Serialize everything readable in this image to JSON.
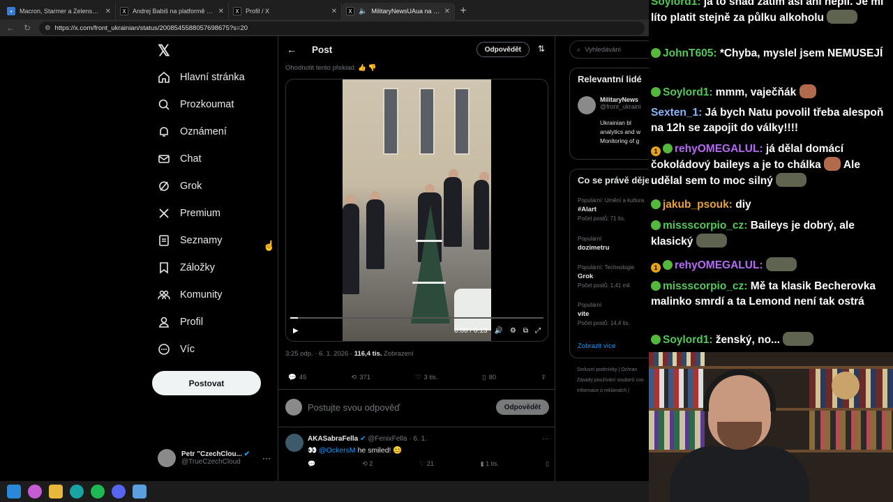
{
  "browser": {
    "tabs": [
      {
        "label": "Macron, Starmer a Zelenskyj pode"
      },
      {
        "label": "Andrej Babiš na platformě X: „Dne"
      },
      {
        "label": "Profil / X"
      },
      {
        "label": "MilitaryNewsUAua na platf"
      }
    ],
    "url": "https://x.com/front_ukrainian/status/2008545588057698675?s=20"
  },
  "xnav": {
    "items": [
      "Hlavní stránka",
      "Prozkoumat",
      "Oznámení",
      "Chat",
      "Grok",
      "Premium",
      "Seznamy",
      "Záložky",
      "Komunity",
      "Profil",
      "Víc"
    ],
    "post_button": "Postovat",
    "user_name": "Petr \"CzechClou...",
    "user_handle": "@TrueCzechCloud"
  },
  "post": {
    "header": "Post",
    "reply_button": "Odpovědět",
    "rate_translation": "Ohodnotit tento překlad:",
    "video_time": "0:00 / 0:13",
    "video_progress": 0.03,
    "timestamp": "3:25 odp. · 6. 1. 2026 · ",
    "views": "116,4 tis.",
    "views_label": "Zobrazení",
    "replies": "45",
    "reposts": "371",
    "likes": "3 tis.",
    "bookmarks": "80",
    "reply_placeholder": "Postujte svou odpověď",
    "reply_submit": "Odpovědět"
  },
  "comment": {
    "name": "AKASabraFella",
    "handle": "@FenixFella · 6. 1.",
    "mention": "@OckersM",
    "text": "he smiled!",
    "replies": "",
    "reposts": "2",
    "likes": "21",
    "views": "1 tis."
  },
  "sidebar": {
    "search_placeholder": "Vyhledávání",
    "relevant_title": "Relevantní lidé",
    "relevant_name": "MilitaryNews",
    "relevant_handle": "@front_ukraini",
    "relevant_bio1": "Ukrainian bl",
    "relevant_bio2": "analytics and w",
    "relevant_bio3": "Monitoring of g",
    "trends_title": "Co se právě děje",
    "trends": [
      {
        "category": "Populární: Umění a kultura",
        "name": "#Alart",
        "count": "Počet postů: 71 tis."
      },
      {
        "category": "Populární",
        "name": "dozimetru",
        "count": ""
      },
      {
        "category": "Populární: Technologie",
        "name": "Grok",
        "count": "Počet postů: 1,41 mil."
      },
      {
        "category": "Populární",
        "name": "víte",
        "count": "Počet postů: 14,4 tis."
      }
    ],
    "show_more": "Zobrazit více",
    "footer1": "Smluvní podmínky  |  Ochran",
    "footer2": "Zásady používání souborů coo",
    "footer3": "Informace o reklamách  |"
  },
  "chat": {
    "messages": [
      {
        "user": "",
        "text": "ja to snad zatim asi ani nepil. Je mi líto platit stejně za půlku alkoholu",
        "color": "#ffffff"
      },
      {
        "user": "JohnT605:",
        "text": "*Chyba, myslel jsem NEMUSEJÍ",
        "color": "#54c85a"
      },
      {
        "user": "Soylord1:",
        "text": "mmm, vaječňák",
        "color": "#54c85a"
      },
      {
        "user": "Sexten_1:",
        "text": "Já bych Natu povolil třeba alespoň na 12h se zapojit do války!!!!",
        "color": "#8ab4f8"
      },
      {
        "user": "rehyOMEGALUL:",
        "text": "já dělal domácí čokoládový baileys a je to chálka",
        "text2": "Ale udělal sem to moc silný",
        "color": "#b36cf2"
      },
      {
        "user": "jakub_psouk:",
        "text": "diy",
        "color": "#e8a33a"
      },
      {
        "user": "missscorpio_cz:",
        "text": "Baileys je dobrý, ale klasický",
        "color": "#54c85a"
      },
      {
        "user": "rehyOMEGALUL:",
        "text": "",
        "color": "#b36cf2"
      },
      {
        "user": "missscorpio_cz:",
        "text": "Mě ta klasik Becherovka malinko smrdí a ta Lemond není tak ostrá",
        "color": "#54c85a"
      },
      {
        "user": "Soylord1:",
        "text": "ženský, no...",
        "color": "#54c85a"
      }
    ],
    "coin_label": "1"
  },
  "colors": {
    "accent": "#1d9bf0",
    "bg": "#000000",
    "border": "#2f3336"
  }
}
